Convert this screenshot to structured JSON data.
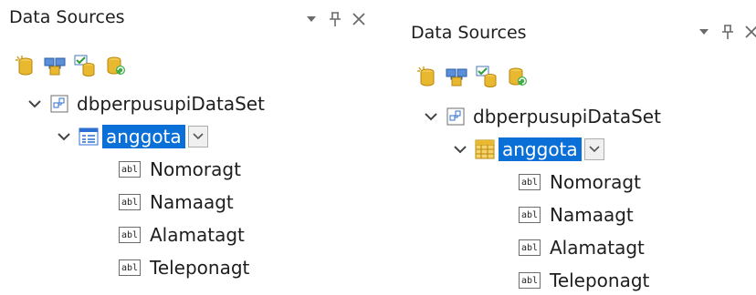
{
  "colors": {
    "selection": "#0a6fd6",
    "text": "#1e1e1e",
    "icon_gold": "#e8b830",
    "icon_blue": "#2c6fd1"
  },
  "panels": [
    {
      "title": "Data Sources",
      "controls": {
        "dropdown_icon": "triangle-down-icon",
        "pin_icon": "pin-icon",
        "close_icon": "close-icon"
      },
      "toolbar": [
        "add-data-source-icon",
        "edit-dataset-designer-icon",
        "configure-dataset-icon",
        "refresh-icon"
      ],
      "tree": {
        "dataset": "dbperpusupiDataSet",
        "table": "anggota",
        "table_view": "details",
        "fields": [
          "Nomoragt",
          "Namaagt",
          "Alamatagt",
          "Teleponagt"
        ],
        "field_icon_text": "abl"
      }
    },
    {
      "title": "Data Sources",
      "controls": {
        "dropdown_icon": "triangle-down-icon",
        "pin_icon": "pin-icon",
        "close_icon": "close-icon"
      },
      "toolbar": [
        "add-data-source-icon",
        "edit-dataset-designer-icon",
        "configure-dataset-icon",
        "refresh-icon"
      ],
      "tree": {
        "dataset": "dbperpusupiDataSet",
        "table": "anggota",
        "table_view": "datagridview",
        "fields": [
          "Nomoragt",
          "Namaagt",
          "Alamatagt",
          "Teleponagt"
        ],
        "field_icon_text": "abl"
      }
    }
  ]
}
